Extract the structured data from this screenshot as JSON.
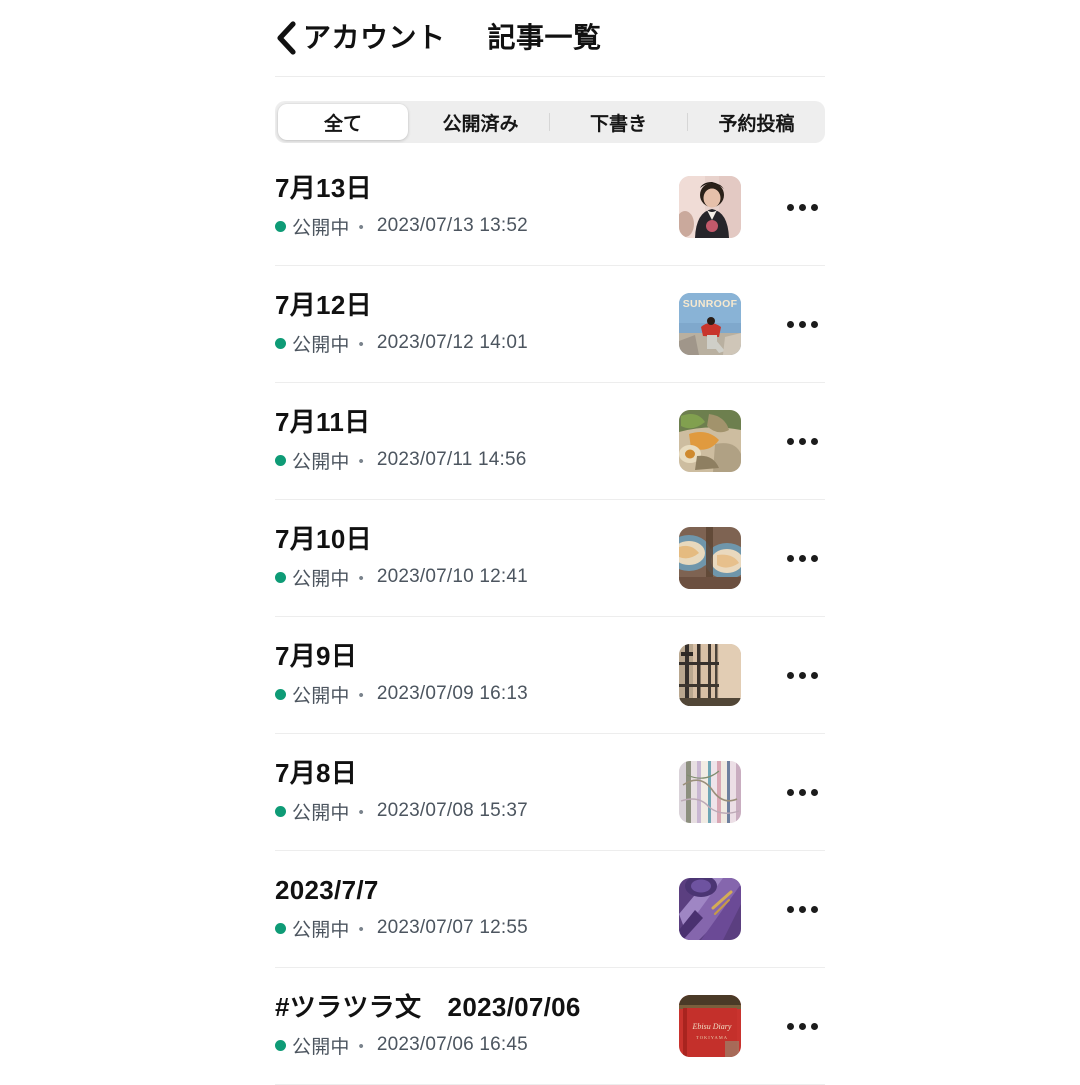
{
  "header": {
    "back_icon": "chevron-left-icon",
    "back_label": "アカウント",
    "title": "記事一覧"
  },
  "filter_tabs": {
    "selected": "全て",
    "items": [
      {
        "label": "全て",
        "selected": true
      },
      {
        "label": "公開済み",
        "selected": false
      },
      {
        "label": "下書き",
        "selected": false
      },
      {
        "label": "予約投稿",
        "selected": false
      }
    ]
  },
  "colors": {
    "status_green": "#0e9b76",
    "track_gray": "#eeeeee",
    "divider": "#ededed",
    "text_primary": "#111111",
    "text_secondary": "#4c555f"
  },
  "articles": [
    {
      "title": "7月13日",
      "status": "公開中",
      "separator": "・",
      "datetime": "2023/07/13 13:52",
      "thumb": "portrait-person-thumbnail",
      "more_icon": "ellipsis-icon"
    },
    {
      "title": "7月12日",
      "status": "公開中",
      "separator": "・",
      "datetime": "2023/07/12 14:01",
      "thumb": "sunroof-album-thumbnail",
      "thumb_text": "SUNROOF",
      "more_icon": "ellipsis-icon"
    },
    {
      "title": "7月11日",
      "status": "公開中",
      "separator": "・",
      "datetime": "2023/07/11 14:56",
      "thumb": "salad-food-thumbnail",
      "more_icon": "ellipsis-icon"
    },
    {
      "title": "7月10日",
      "status": "公開中",
      "separator": "・",
      "datetime": "2023/07/10 12:41",
      "thumb": "blue-plate-food-thumbnail",
      "more_icon": "ellipsis-icon"
    },
    {
      "title": "7月9日",
      "status": "公開中",
      "separator": "・",
      "datetime": "2023/07/09 16:13",
      "thumb": "scaffolding-thumbnail",
      "more_icon": "ellipsis-icon"
    },
    {
      "title": "7月8日",
      "status": "公開中",
      "separator": "・",
      "datetime": "2023/07/08 15:37",
      "thumb": "pastel-abstract-thumbnail",
      "more_icon": "ellipsis-icon"
    },
    {
      "title": "2023/7/7",
      "status": "公開中",
      "separator": "・",
      "datetime": "2023/07/07 12:55",
      "thumb": "purple-stripes-thumbnail",
      "more_icon": "ellipsis-icon"
    },
    {
      "title": "#ツラツラ文　2023/07/06",
      "status": "公開中",
      "separator": "・",
      "datetime": "2023/07/06 16:45",
      "thumb": "red-diary-book-thumbnail",
      "thumb_text": "Ebisu Diary",
      "more_icon": "ellipsis-icon"
    }
  ]
}
